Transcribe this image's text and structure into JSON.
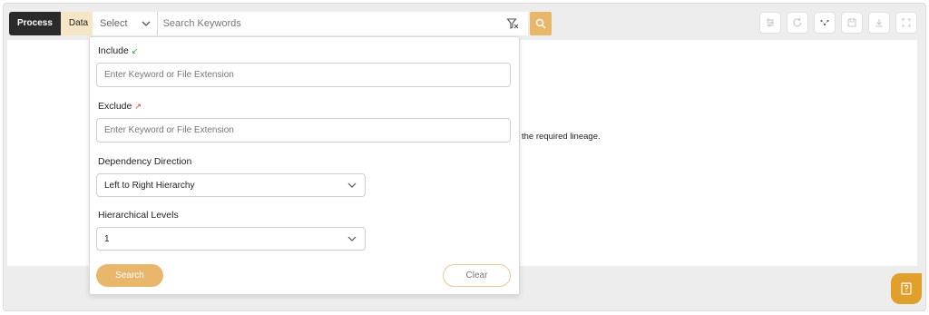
{
  "toolbar": {
    "toggle": {
      "process_label": "Process",
      "data_label": "Data"
    },
    "select_label": "Select",
    "search_placeholder": "Search Keywords",
    "icons": [
      "filter-clear-icon",
      "search-icon",
      "settings-sliders-icon",
      "refresh-icon",
      "lineage-graph-icon",
      "save-icon",
      "download-icon",
      "fullscreen-icon"
    ]
  },
  "main": {
    "hint_text": "the required lineage."
  },
  "search_panel": {
    "include_label": "Include",
    "include_placeholder": "Enter Keyword or File Extension",
    "exclude_label": "Exclude",
    "exclude_placeholder": "Enter Keyword or File Extension",
    "direction_label": "Dependency Direction",
    "direction_value": "Left to Right Hierarchy",
    "levels_label": "Hierarchical Levels",
    "levels_value": "1",
    "search_button": "Search",
    "clear_button": "Clear"
  },
  "colors": {
    "accent": "#e8b76b",
    "active_toggle": "#2b2b2b",
    "inactive_toggle": "#f6e6c6",
    "include_arrow": "#2e9e3e",
    "exclude_arrow": "#e0362b",
    "help_button": "#e0a02b"
  }
}
